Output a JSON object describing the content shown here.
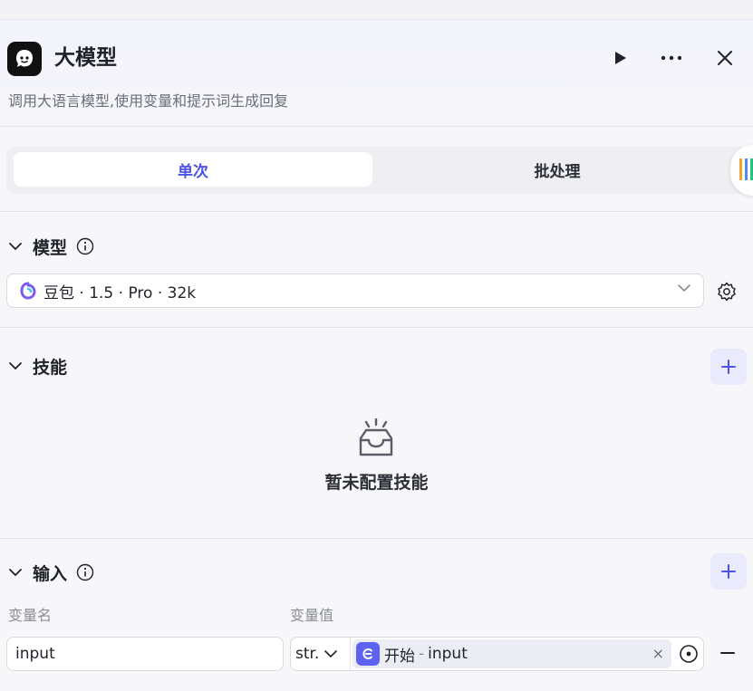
{
  "header": {
    "title": "大模型",
    "description": "调用大语言模型,使用变量和提示词生成回复",
    "logo_icon": "assistant-avatar-icon",
    "run_icon": "play-icon",
    "more_icon": "more-horizontal-icon",
    "close_icon": "close-icon"
  },
  "tabs": [
    {
      "label": "单次",
      "active": true
    },
    {
      "label": "批处理",
      "active": false
    }
  ],
  "model_section": {
    "title": "模型",
    "selected_model": "豆包 · 1.5 · Pro · 32k",
    "settings_icon": "gear-icon"
  },
  "skills_section": {
    "title": "技能",
    "empty_text": "暂未配置技能"
  },
  "input_section": {
    "title": "输入",
    "col_name_label": "变量名",
    "col_value_label": "变量值",
    "rows": [
      {
        "name": "input",
        "type": "str.",
        "ref_node": "开始",
        "ref_separator": "-",
        "ref_var": "input",
        "clear_symbol": "×"
      }
    ]
  },
  "colors": {
    "accent": "#4d53e8",
    "add_button_bg": "#e9eafb",
    "ref_icon_bg": "#5d63f0"
  }
}
